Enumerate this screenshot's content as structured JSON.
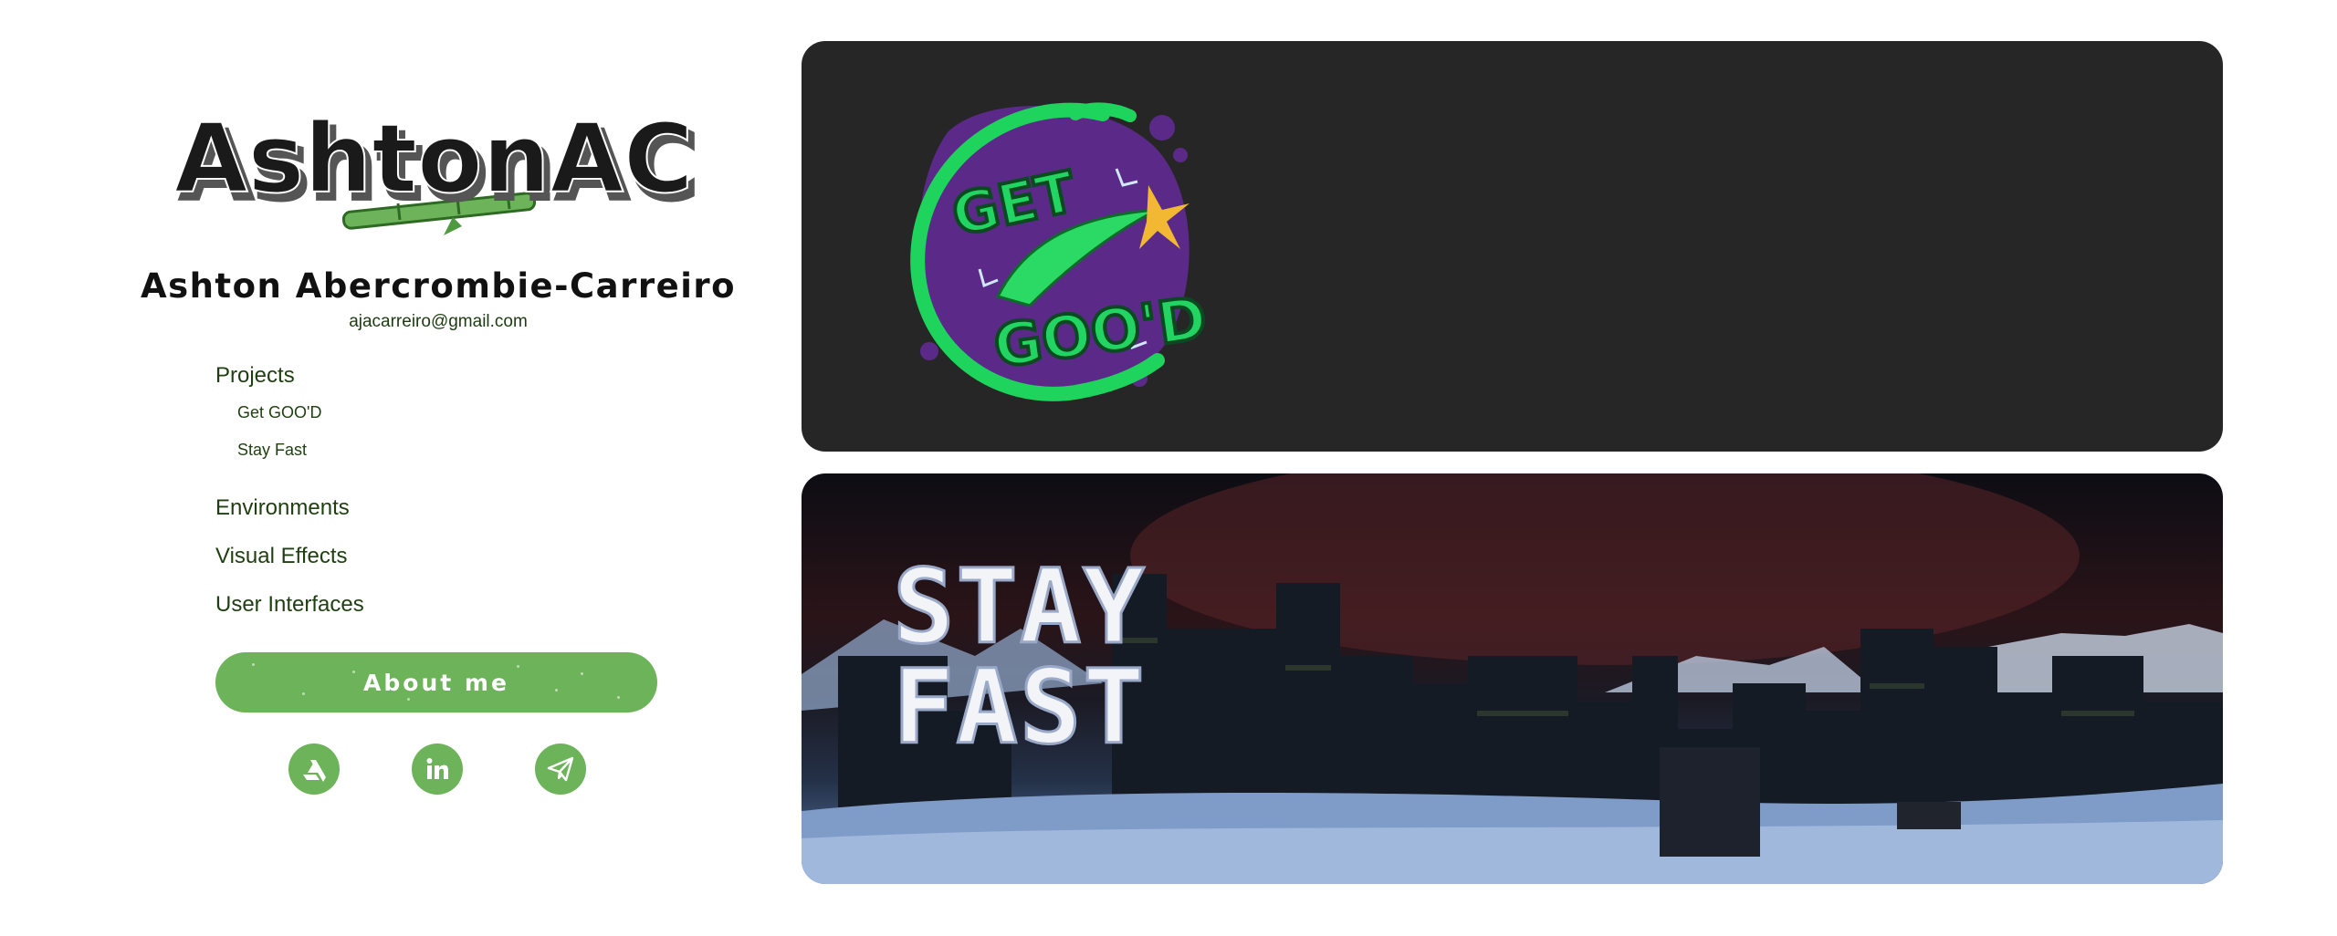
{
  "sidebar": {
    "logo_text": "AshtonAC",
    "owner_name": "Ashton Abercrombie-Carreiro",
    "email": "ajacarreiro@gmail.com",
    "nav": {
      "projects_label": "Projects",
      "projects_children": [
        "Get GOO'D",
        "Stay Fast"
      ],
      "environments_label": "Environments",
      "visual_effects_label": "Visual Effects",
      "user_interfaces_label": "User Interfaces"
    },
    "about_button_label": "About me",
    "socials": [
      {
        "icon": "artstation-icon"
      },
      {
        "icon": "linkedin-icon"
      },
      {
        "icon": "send-icon"
      }
    ],
    "colors": {
      "accent": "#6db35a",
      "nav_text": "#1e3f10"
    }
  },
  "projects": [
    {
      "logo_line1": "GET",
      "logo_line2": "GOO'D",
      "background": "#262626"
    },
    {
      "logo_line1": "STAY",
      "logo_line2": "FAST"
    }
  ]
}
